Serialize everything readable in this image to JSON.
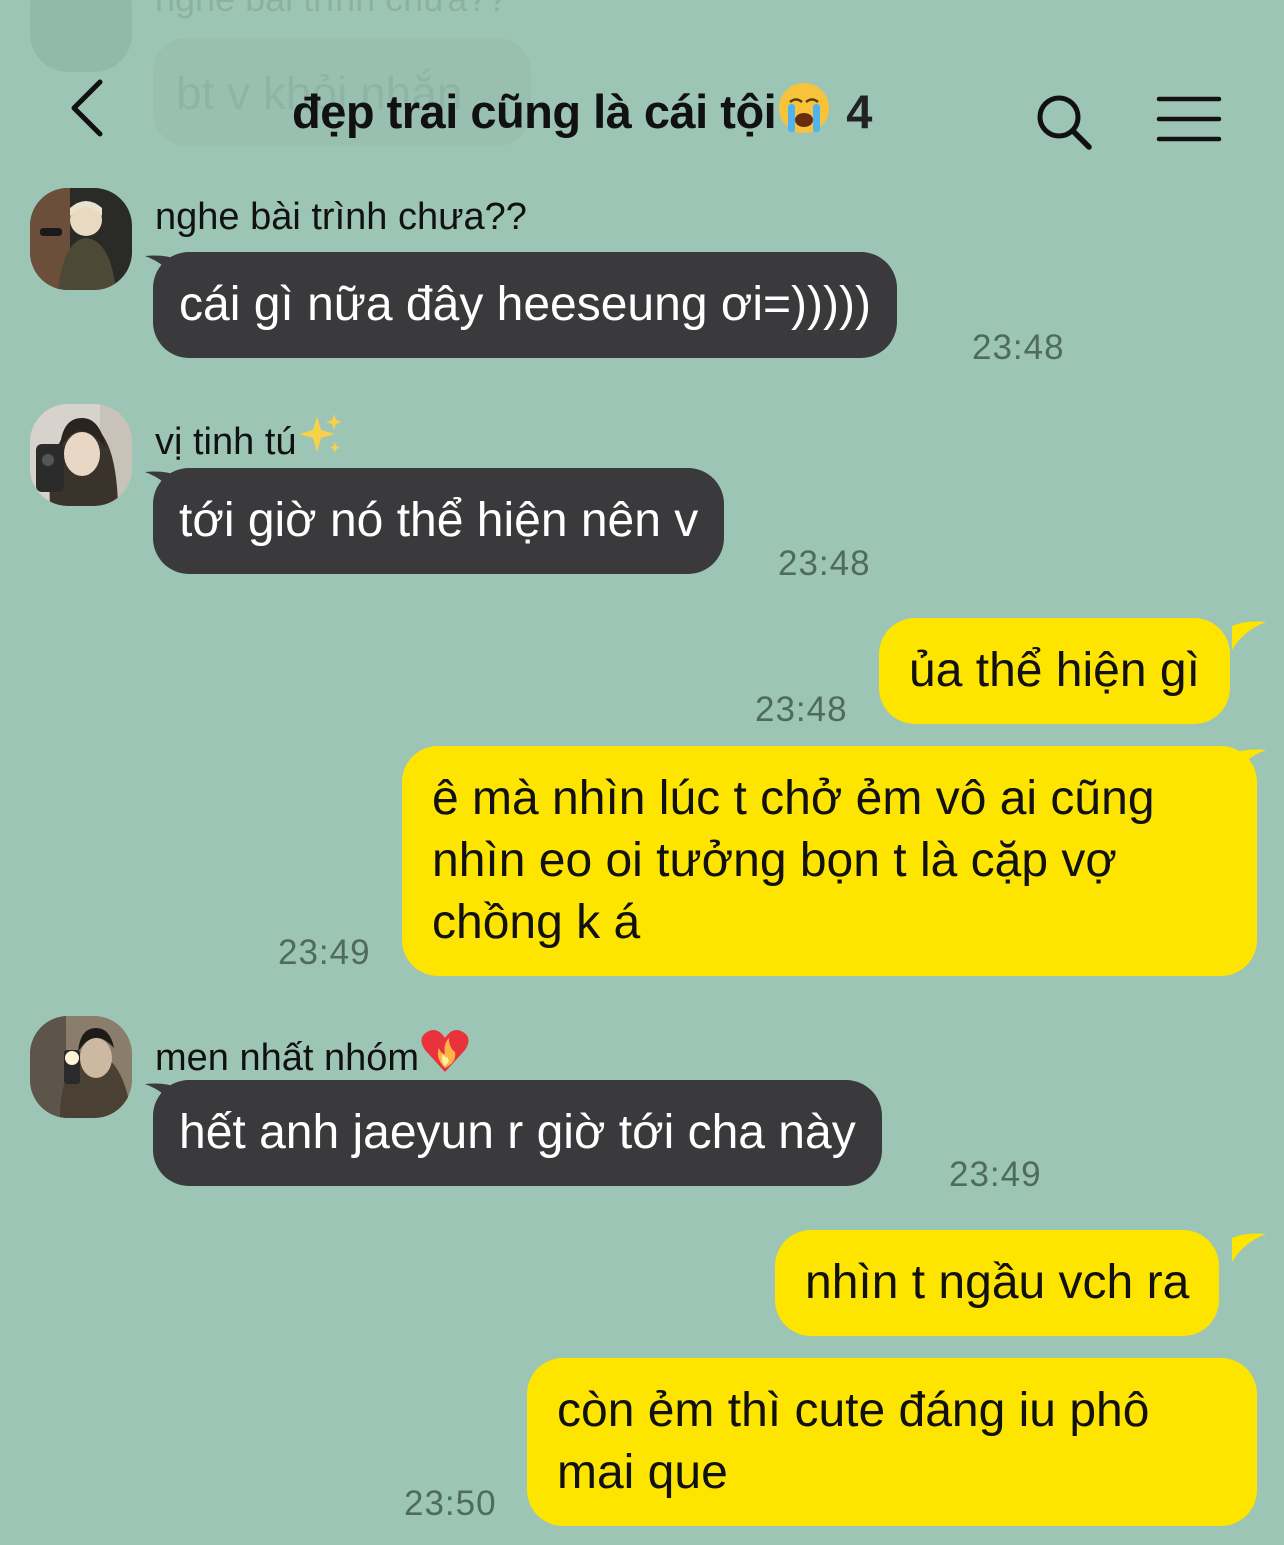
{
  "previous": {
    "sender": "nghe bài trình chưa??",
    "message": "bt v khỏi nhắn"
  },
  "header": {
    "title": "đẹp trai cũng là cái tội",
    "member_count": "4",
    "back_icon": "chevron-left-icon",
    "search_icon": "search-icon",
    "menu_icon": "hamburger-menu-icon"
  },
  "messages": [
    {
      "sender": "nghe bài trình chưa??",
      "text": "cái gì nữa đây heeseung ơi=)))))",
      "time": "23:48"
    },
    {
      "sender": "vị tinh tú",
      "text": "tới giờ nó thể hiện nên v",
      "time": "23:48"
    },
    {
      "text": "ủa thể hiện gì",
      "time": "23:48"
    },
    {
      "text": "ê mà nhìn lúc t chở ẻm vô ai cũng nhìn eo oi tưởng bọn t là cặp vợ chồng k á",
      "time": "23:49"
    },
    {
      "sender": "men nhất nhóm",
      "text": "hết anh jaeyun r giờ tới cha này",
      "time": "23:49"
    },
    {
      "text": "nhìn t ngầu vch ra",
      "time": ""
    },
    {
      "text": "còn ẻm thì cute đáng iu phô mai que",
      "time": "23:50"
    }
  ],
  "colors": {
    "background": "#9dc5b5",
    "incoming_bubble": "#3a3a3c",
    "outgoing_bubble": "#fee500"
  }
}
